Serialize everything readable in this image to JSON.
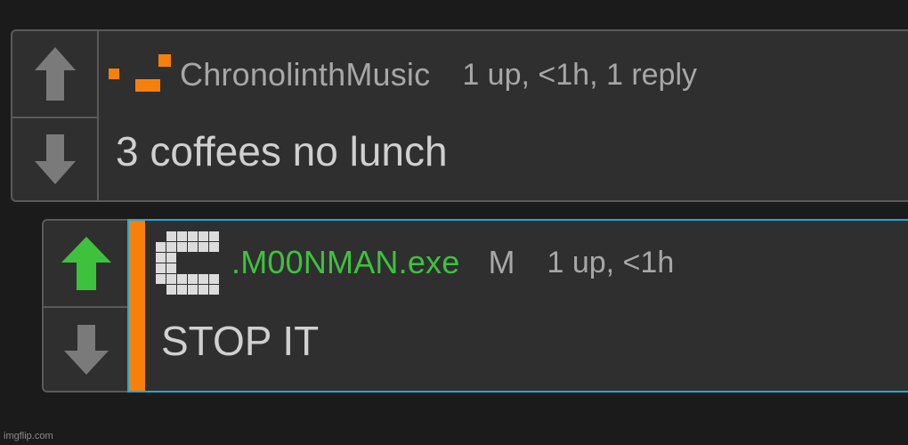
{
  "comments": [
    {
      "username": "ChronolinthMusic",
      "meta": "1 up, <1h, 1 reply",
      "text": "3 coffees no lunch",
      "upvoted": false
    },
    {
      "username": ".M00NMAN.exe",
      "mod_flag": "M",
      "meta": "1 up, <1h",
      "text": "STOP IT",
      "upvoted": true
    }
  ],
  "icons": {
    "upvote": "arrow-up-icon",
    "downvote": "arrow-down-icon"
  },
  "colors": {
    "background": "#1b1b1b",
    "panel": "#2f2f2f",
    "border": "#5a5a5a",
    "vote_inactive": "#7a7a7a",
    "vote_active": "#3ec23e",
    "username_highlight": "#3ec23e",
    "reply_accent": "#f7800a",
    "reply_frame": "#1fa8d8",
    "text": "#d0d0d0",
    "meta_text": "#a7a7a7"
  },
  "watermark": "imgflip.com"
}
